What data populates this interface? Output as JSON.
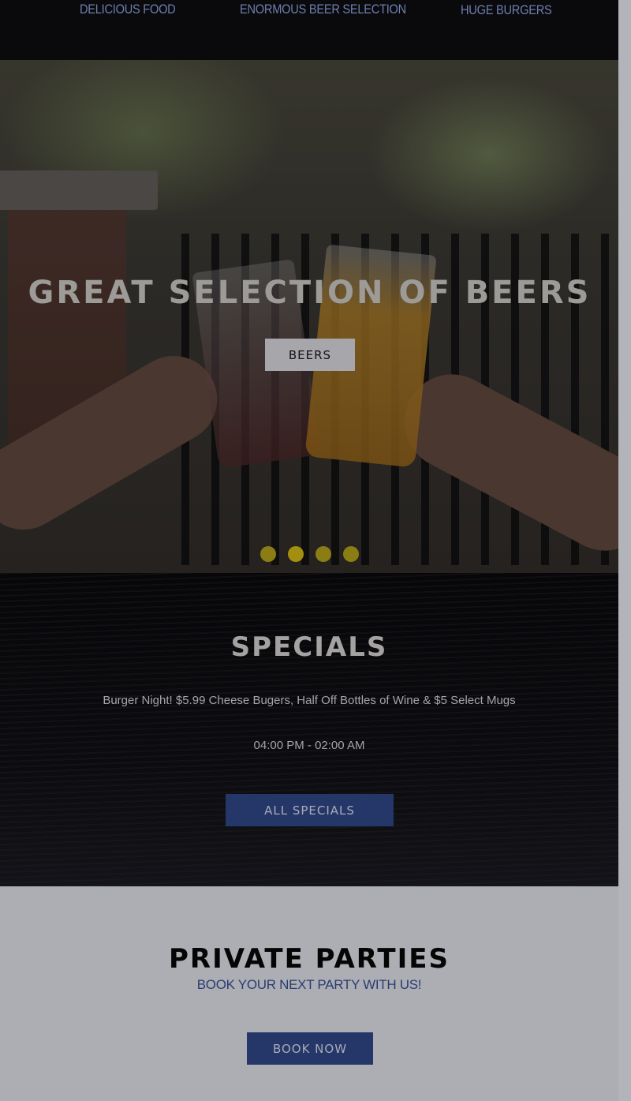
{
  "features": {
    "item1": "DELICIOUS FOOD",
    "item2": "ENORMOUS BEER SELECTION",
    "item3": "HUGE BURGERS"
  },
  "hero": {
    "title": "GREAT SELECTION OF BEERS",
    "button_label": "BEERS",
    "slides_total": 4,
    "active_slide": 2,
    "dot_color": "#8a7d14"
  },
  "specials": {
    "title": "SPECIALS",
    "description": "Burger Night! $5.99 Cheese Bugers, Half Off Bottles of Wine & $5 Select Mugs",
    "hours": "04:00 PM - 02:00 AM",
    "button_label": "ALL SPECIALS"
  },
  "parties": {
    "title": "PRIVATE PARTIES",
    "subtitle": "BOOK YOUR NEXT PARTY WITH US!",
    "button_label": "BOOK NOW"
  },
  "colors": {
    "accent_blue": "#253668",
    "page_background": "#adaeb4",
    "dark_band": "#0a0a0c"
  }
}
